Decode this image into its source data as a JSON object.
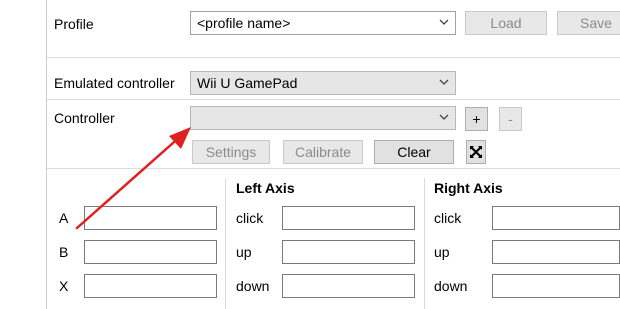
{
  "profile": {
    "label": "Profile",
    "value": "<profile name>",
    "load_label": "Load",
    "save_label": "Save"
  },
  "emulated": {
    "label": "Emulated controller",
    "value": "Wii U GamePad"
  },
  "controller": {
    "label": "Controller",
    "value": "",
    "add_label": "+",
    "remove_label": "-"
  },
  "actions": {
    "settings_label": "Settings",
    "calibrate_label": "Calibrate",
    "clear_label": "Clear"
  },
  "buttons": {
    "a": "A",
    "b": "B",
    "x": "X"
  },
  "left_axis": {
    "title": "Left Axis",
    "click": "click",
    "up": "up",
    "down": "down"
  },
  "right_axis": {
    "title": "Right Axis",
    "click": "click",
    "up": "up",
    "down": "down"
  },
  "annotation": {
    "arrow_color": "#e02020"
  },
  "icons": {
    "dropdown": "chevron-down-icon",
    "auto_detect": "arrows-cross-icon"
  }
}
